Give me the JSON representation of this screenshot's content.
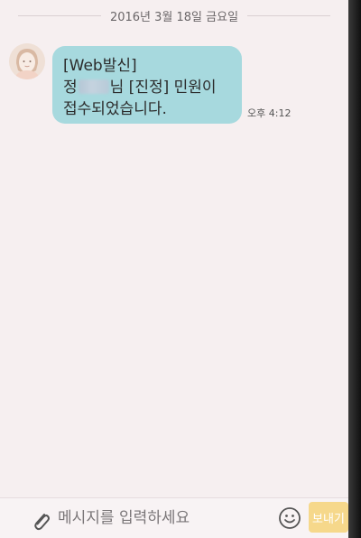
{
  "chat": {
    "date_divider": "2016년 3월 18일 금요일",
    "message": {
      "line1": "[Web발신]",
      "line2_prefix": "정",
      "line2_suffix": "님 [진정] 민원이",
      "line3": "접수되었습니다.",
      "time": "오후 4:12"
    }
  },
  "input_bar": {
    "placeholder": "메시지를 입력하세요",
    "send_label": "보내기"
  },
  "icons": {
    "attach": "paperclip-icon",
    "emoji": "smiley-icon",
    "avatar": "default-avatar-icon"
  },
  "colors": {
    "background": "#f6eff0",
    "bubble": "#a7d9de",
    "send_button": "#f6d88b"
  }
}
